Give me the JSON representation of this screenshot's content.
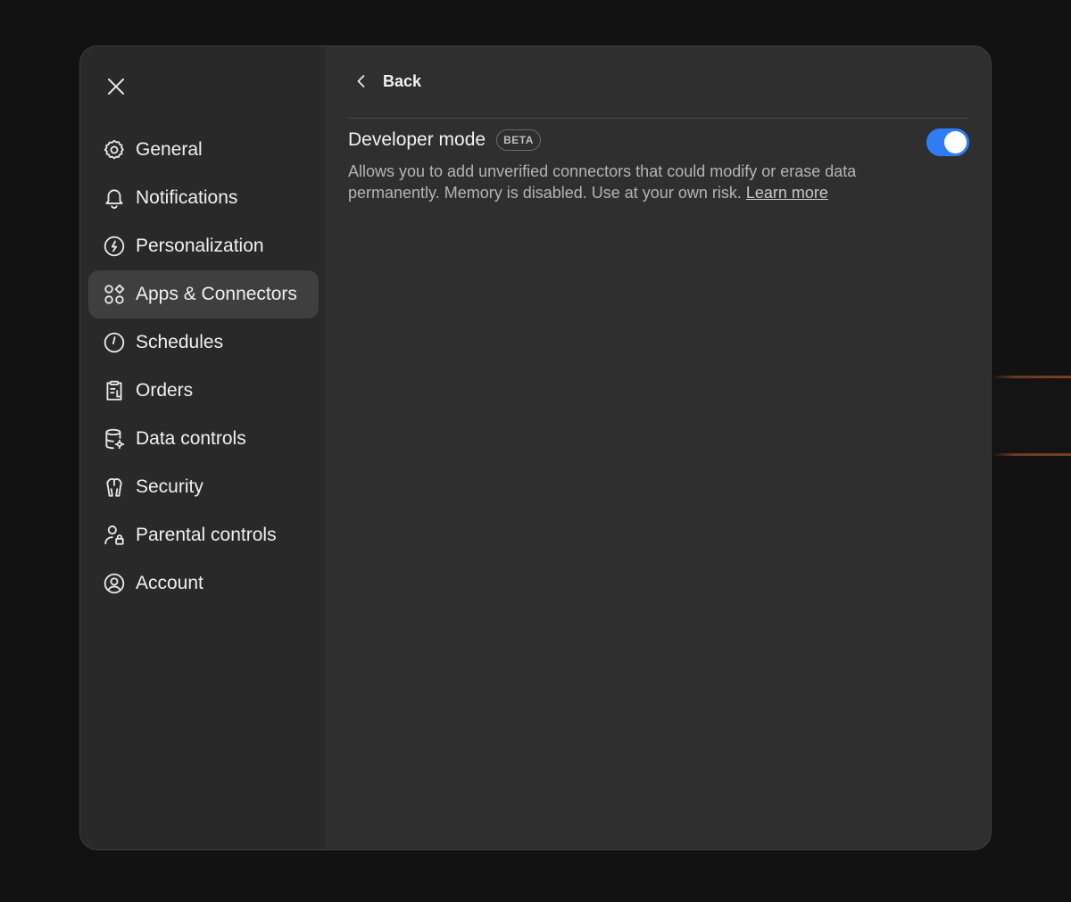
{
  "sidebar": {
    "close_icon": "close-icon",
    "items": [
      {
        "label": "General",
        "icon": "gear-icon"
      },
      {
        "label": "Notifications",
        "icon": "bell-icon"
      },
      {
        "label": "Personalization",
        "icon": "personalization-icon"
      },
      {
        "label": "Apps & Connectors",
        "icon": "apps-icon"
      },
      {
        "label": "Schedules",
        "icon": "clock-icon"
      },
      {
        "label": "Orders",
        "icon": "orders-icon"
      },
      {
        "label": "Data controls",
        "icon": "database-icon"
      },
      {
        "label": "Security",
        "icon": "security-icon"
      },
      {
        "label": "Parental controls",
        "icon": "parental-icon"
      },
      {
        "label": "Account",
        "icon": "account-icon"
      }
    ],
    "active_item": "Apps & Connectors"
  },
  "content": {
    "back_label": "Back",
    "setting": {
      "title": "Developer mode",
      "badge": "BETA",
      "description": "Allows you to add unverified connectors that could modify or erase data permanently. Memory is disabled. Use at your own risk.",
      "link_label": "Learn more",
      "enabled": true
    }
  },
  "colors": {
    "toggle_on": "#2f7df6",
    "modal_bg": "#2f2f2f",
    "sidebar_bg": "#292929",
    "active_bg": "#3f3f3f"
  }
}
